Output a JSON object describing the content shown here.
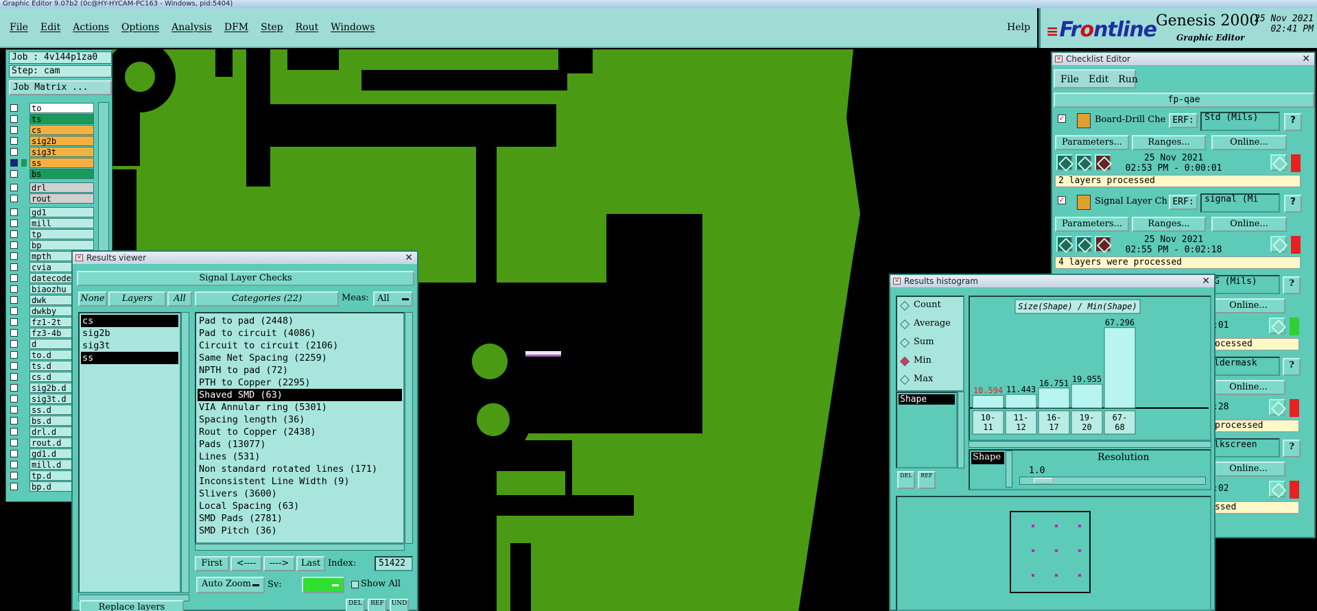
{
  "os_title": "Graphic Editor 9.07b2 (0c@HY-HYCAM-PC163 - Windows, pid:5404)",
  "menu": {
    "items": [
      "File",
      "Edit",
      "Actions",
      "Options",
      "Analysis",
      "DFM",
      "Step",
      "Rout",
      "Windows"
    ],
    "help": "Help"
  },
  "brand": {
    "logo_pre": "Fr",
    "logo_o": "o",
    "logo_post": "ntline",
    "product": "Genesis 2000",
    "subtitle": "Graphic Editor",
    "date": "25 Nov 2021",
    "time": "02:41 PM"
  },
  "left": {
    "job": "Job : 4v144p1za0",
    "step": "Step: cam",
    "job_matrix": "Job Matrix ...",
    "layers": [
      {
        "name": "to",
        "color": "#ffffff",
        "checked": false
      },
      {
        "name": "ts",
        "color": "#1a9a5a",
        "checked": false
      },
      {
        "name": "cs",
        "color": "#f4b040",
        "checked": false
      },
      {
        "name": "sig2b",
        "color": "#f4b040",
        "checked": false
      },
      {
        "name": "sig3t",
        "color": "#f4b040",
        "checked": false
      },
      {
        "name": "ss",
        "color": "#f4b040",
        "checked": true
      },
      {
        "name": "bs",
        "color": "#1a9a5a",
        "checked": false
      },
      {
        "name": "drl",
        "color": "#d0d0d0",
        "checked": false
      },
      {
        "name": "rout",
        "color": "#d0d0d0",
        "checked": false
      },
      {
        "name": "gd1",
        "color": "#b8ece4",
        "checked": false
      },
      {
        "name": "mill",
        "color": "#b8ece4",
        "checked": false
      },
      {
        "name": "tp",
        "color": "#b8ece4",
        "checked": false
      },
      {
        "name": "bp",
        "color": "#b8ece4",
        "checked": false
      },
      {
        "name": "mpth",
        "color": "#b8ece4",
        "checked": false
      },
      {
        "name": "cvia",
        "color": "#b8ece4",
        "checked": false
      },
      {
        "name": "datecode",
        "color": "#b8ece4",
        "checked": false
      },
      {
        "name": "biaozhu",
        "color": "#b8ece4",
        "checked": false
      },
      {
        "name": "dwk",
        "color": "#b8ece4",
        "checked": false
      },
      {
        "name": "dwkby",
        "color": "#b8ece4",
        "checked": false
      },
      {
        "name": "fz1-2t",
        "color": "#b8ece4",
        "checked": false
      },
      {
        "name": "fz3-4b",
        "color": "#b8ece4",
        "checked": false
      },
      {
        "name": "d",
        "color": "#b8ece4",
        "checked": false
      },
      {
        "name": "to.d",
        "color": "#b8ece4",
        "checked": false
      },
      {
        "name": "ts.d",
        "color": "#b8ece4",
        "checked": false
      },
      {
        "name": "cs.d",
        "color": "#b8ece4",
        "checked": false
      },
      {
        "name": "sig2b.d",
        "color": "#b8ece4",
        "checked": false
      },
      {
        "name": "sig3t.d",
        "color": "#b8ece4",
        "checked": false
      },
      {
        "name": "ss.d",
        "color": "#b8ece4",
        "checked": false
      },
      {
        "name": "bs.d",
        "color": "#b8ece4",
        "checked": false
      },
      {
        "name": "drl.d",
        "color": "#b8ece4",
        "checked": false
      },
      {
        "name": "rout.d",
        "color": "#b8ece4",
        "checked": false
      },
      {
        "name": "gd1.d",
        "color": "#b8ece4",
        "checked": false
      },
      {
        "name": "mill.d",
        "color": "#b8ece4",
        "checked": false
      },
      {
        "name": "tp.d",
        "color": "#b8ece4",
        "checked": false
      },
      {
        "name": "bp.d",
        "color": "#b8ece4",
        "checked": false
      }
    ]
  },
  "results_viewer": {
    "title": "Results viewer",
    "header": "Signal Layer Checks",
    "none": "None",
    "layers_label": "Layers",
    "all": "All",
    "categories_label": "Categories (22)",
    "meas_label": "Meas:",
    "meas_value": "All",
    "layers": [
      {
        "name": "cs",
        "selected": true
      },
      {
        "name": "sig2b",
        "selected": false
      },
      {
        "name": "sig3t",
        "selected": false
      },
      {
        "name": "ss",
        "selected": true
      }
    ],
    "categories": [
      {
        "label": "Pad to pad (2448)",
        "selected": false
      },
      {
        "label": "Pad to circuit (4086)",
        "selected": false
      },
      {
        "label": "Circuit to circuit (2106)",
        "selected": false
      },
      {
        "label": "Same Net Spacing (2259)",
        "selected": false
      },
      {
        "label": "NPTH to pad (72)",
        "selected": false
      },
      {
        "label": "PTH to Copper (2295)",
        "selected": false
      },
      {
        "label": "Shaved SMD (63)",
        "selected": true
      },
      {
        "label": "VIA Annular ring (5301)",
        "selected": false
      },
      {
        "label": "Spacing length (36)",
        "selected": false
      },
      {
        "label": "Rout to Copper (2438)",
        "selected": false
      },
      {
        "label": "Pads (13077)",
        "selected": false
      },
      {
        "label": "Lines (531)",
        "selected": false
      },
      {
        "label": "Non standard rotated lines (171)",
        "selected": false
      },
      {
        "label": "Inconsistent Line Width (9)",
        "selected": false
      },
      {
        "label": "Slivers (3600)",
        "selected": false
      },
      {
        "label": "Local Spacing (63)",
        "selected": false
      },
      {
        "label": "SMD Pads (2781)",
        "selected": false
      },
      {
        "label": "SMD Pitch (36)",
        "selected": false
      }
    ],
    "first": "First",
    "prev": "<----",
    "next": "---->",
    "last": "Last",
    "index_label": "Index:",
    "index_value": "51422",
    "auto_zoom": "Auto Zoom",
    "sv_label": "Sv:",
    "show_all": "Show All",
    "replace_layers": "Replace layers",
    "del": "DEL",
    "ref": "REF",
    "und": "UND"
  },
  "checklist": {
    "title": "Checklist Editor",
    "menu": [
      "File",
      "Edit",
      "Run"
    ],
    "name": "fp-qae",
    "erf_label": "ERF:",
    "params_label": "Parameters...",
    "ranges_label": "Ranges...",
    "online_label": "Online...",
    "checks": [
      {
        "name": "Board-Drill Che",
        "erf_value": "Std (Mils)",
        "date": "25 Nov 2021",
        "time": "02:53 PM - 0:00:01",
        "status": "2 layers processed"
      },
      {
        "name": "Signal Layer Ch",
        "erf_value": "signal (Mi",
        "date": "25 Nov 2021",
        "time": "02:55 PM - 0:02:18",
        "status": "4 layers were processed"
      }
    ],
    "partial": [
      {
        "erf": "G (Mils)",
        "time": ":01",
        "status": "ocessed"
      },
      {
        "erf": "ldermask",
        "time": ":28",
        "status": "processed"
      },
      {
        "erf": "lkscreen",
        "time": ":02",
        "status": "ssed"
      }
    ]
  },
  "histogram": {
    "title": "Results histogram",
    "options": [
      {
        "label": "Count",
        "selected": false
      },
      {
        "label": "Average",
        "selected": false
      },
      {
        "label": "Sum",
        "selected": false
      },
      {
        "label": "Min",
        "selected": true
      },
      {
        "label": "Max",
        "selected": false
      }
    ],
    "list_item": "Shape",
    "chart_title": "Size(Shape) / Min(Shape)",
    "resolution_label": "Resolution",
    "resolution_value": "1.0",
    "shape_label": "Shape",
    "del": "DEL",
    "ref": "REF"
  },
  "chart_data": {
    "type": "bar",
    "title": "Size(Shape) / Min(Shape)",
    "categories": [
      "10-11",
      "11-12",
      "16-17",
      "19-20",
      "67-68"
    ],
    "values": [
      10.594,
      11.443,
      16.751,
      19.955,
      67.296
    ],
    "value_labels": [
      "10.594",
      "11.443",
      "16.751",
      "19.955",
      "67.296"
    ],
    "ylim": [
      0,
      70
    ],
    "highlight_color": "#e02020"
  },
  "colors": {
    "copper": "#4a9a14",
    "panel": "#5ecab8",
    "title_bar": "#9fdcd6"
  }
}
